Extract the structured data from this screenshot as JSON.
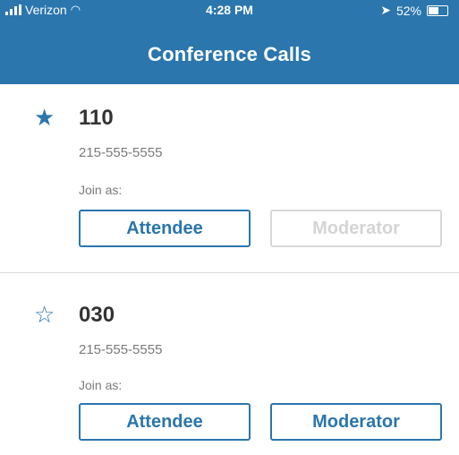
{
  "status_bar": {
    "carrier": "Verizon",
    "time": "4:28 PM",
    "battery": "52%",
    "battery_level": 0.52
  },
  "header": {
    "title": "Conference Calls"
  },
  "conferences": [
    {
      "number": "110",
      "phone": "215-555-5555",
      "favorite": true,
      "star_icon": "★",
      "join_label": "Join as:",
      "attendee_label": "Attendee",
      "moderator_label": "Moderator",
      "moderator_enabled": false
    },
    {
      "number": "030",
      "phone": "215-555-5555",
      "favorite": false,
      "star_icon": "☆",
      "join_label": "Join as:",
      "attendee_label": "Attendee",
      "moderator_label": "Moderator",
      "moderator_enabled": true
    }
  ],
  "colors": {
    "brand": "#2a76ad",
    "disabled": "#d8d8d8",
    "muted_text": "#7a7a7a"
  }
}
